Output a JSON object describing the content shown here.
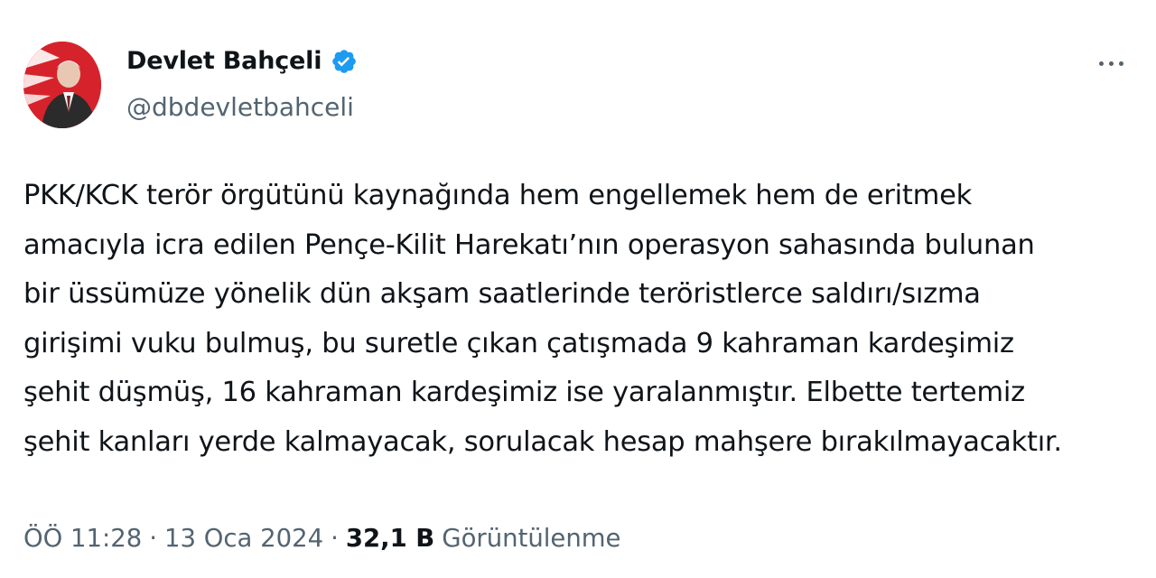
{
  "author": {
    "display_name": "Devlet Bahçeli",
    "handle": "@dbdevletbahceli",
    "verified": true,
    "accent_color": "#1d9bf0"
  },
  "tweet": {
    "lines": [
      "PKK/KCK terör örgütünü kaynağında hem engellemek hem de eritmek",
      "amacıyla icra edilen Pençe-Kilit Harekatı’nın operasyon sahasında bulunan",
      "bir üssümüze yönelik dün akşam saatlerinde teröristlerce saldırı/sızma",
      "girişimi vuku bulmuş, bu suretle çıkan çatışmada 9 kahraman kardeşimiz",
      "şehit düşmüş, 16 kahraman kardeşimiz ise yaralanmıştır. Elbette tertemiz",
      "şehit kanları yerde kalmayacak, sorulacak hesap mahşere bırakılmayacaktır."
    ]
  },
  "meta": {
    "time": "ÖÖ 11:28",
    "date": "13 Oca 2024",
    "separator": "·",
    "views_count": "32,1 B",
    "views_label": "Görüntülenme"
  },
  "icons": {
    "more": "more-horizontal-icon",
    "verified": "verified-badge-icon"
  }
}
